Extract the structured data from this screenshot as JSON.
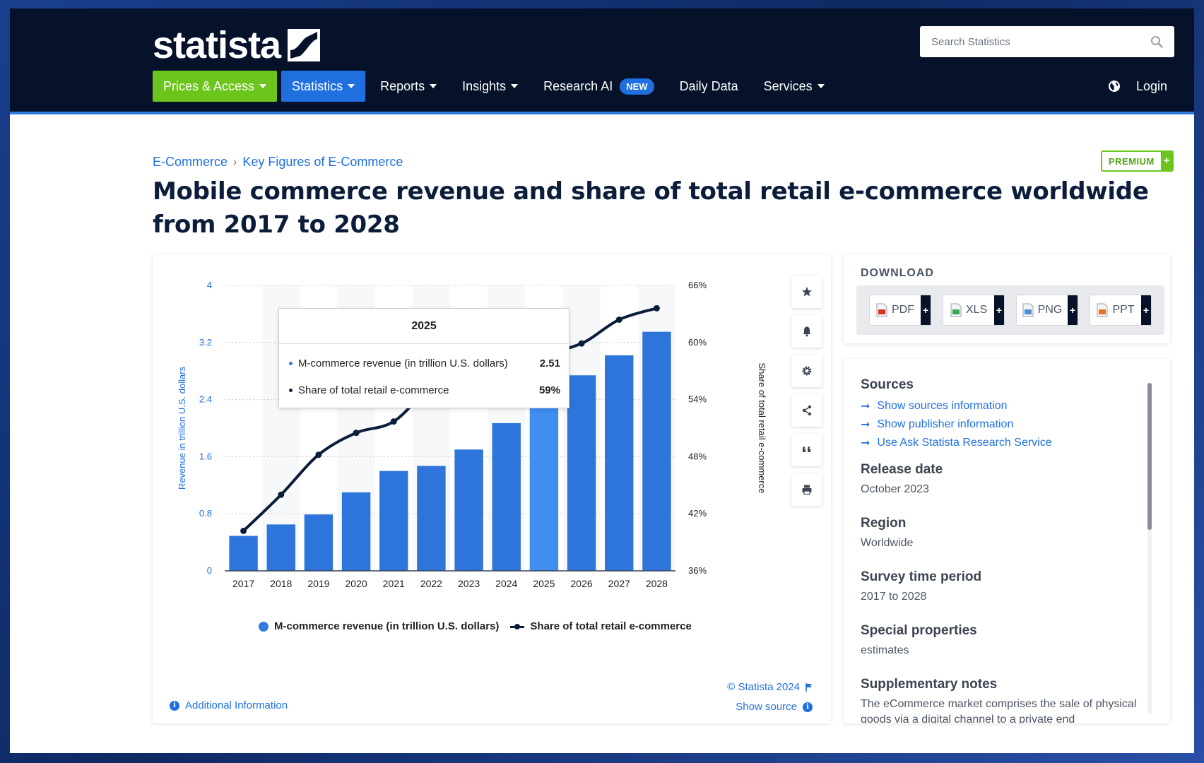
{
  "header": {
    "logo_text": "statista",
    "search_placeholder": "Search Statistics",
    "nav": [
      {
        "label": "Prices & Access",
        "style": "green",
        "caret": true
      },
      {
        "label": "Statistics",
        "style": "blue",
        "caret": true
      },
      {
        "label": "Reports",
        "style": "",
        "caret": true
      },
      {
        "label": "Insights",
        "style": "",
        "caret": true
      },
      {
        "label": "Research AI",
        "style": "",
        "caret": false,
        "badge": "NEW"
      },
      {
        "label": "Daily Data",
        "style": "",
        "caret": false
      },
      {
        "label": "Services",
        "style": "",
        "caret": true
      }
    ],
    "login_label": "Login"
  },
  "breadcrumb": {
    "items": [
      "E-Commerce",
      "Key Figures of E-Commerce"
    ],
    "separator": "›"
  },
  "premium_label": "PREMIUM",
  "premium_plus": "+",
  "title": "Mobile commerce revenue and share of total retail e-commerce worldwide from 2017 to 2028",
  "chart_data": {
    "type": "bar",
    "categories": [
      "2017",
      "2018",
      "2019",
      "2020",
      "2021",
      "2022",
      "2023",
      "2024",
      "2025",
      "2026",
      "2027",
      "2028"
    ],
    "series": [
      {
        "name": "M-commerce revenue (in trillion U.S. dollars)",
        "type": "bar",
        "axis": "left",
        "values": [
          0.49,
          0.65,
          0.79,
          1.1,
          1.4,
          1.47,
          1.7,
          2.07,
          2.51,
          2.74,
          3.02,
          3.35
        ]
      },
      {
        "name": "Share of total retail e-commerce",
        "type": "line",
        "axis": "right",
        "values": [
          40.2,
          44,
          48.2,
          50.5,
          51.7,
          55.5,
          58.2,
          59.5,
          59,
          59.9,
          62.4,
          63.6
        ]
      }
    ],
    "ylabel": "Revenue in trillion U.S. dollars",
    "y2label": "Share of total retail e-commerce",
    "ylim": [
      0,
      4
    ],
    "yticks": [
      "0",
      "0.8",
      "1.6",
      "2.4",
      "3.2",
      "4"
    ],
    "y2lim": [
      36,
      66
    ],
    "y2ticks": [
      "36%",
      "42%",
      "48%",
      "54%",
      "60%",
      "66%"
    ],
    "highlight_index": 8,
    "colors": {
      "bar": "#2d74db",
      "bar_highlight": "#3f8ef0",
      "line": "#0b1d3a"
    },
    "legend_position": "bottom",
    "grid": true,
    "tooltip": {
      "title": "2025",
      "rows": [
        {
          "label": "M-commerce revenue (in trillion U.S. dollars)",
          "value": "2.51"
        },
        {
          "label": "Share of total retail e-commerce",
          "value": "59%"
        }
      ]
    }
  },
  "chart_footer": {
    "copyright": "© Statista 2024",
    "show_source": "Show source",
    "additional_info": "Additional Information"
  },
  "tools": [
    "star-icon",
    "bell-icon",
    "gear-icon",
    "share-icon",
    "quote-icon",
    "print-icon"
  ],
  "download": {
    "title": "DOWNLOAD",
    "buttons": [
      {
        "label": "PDF",
        "icon": "pdf-file-icon"
      },
      {
        "label": "XLS",
        "icon": "xls-file-icon"
      },
      {
        "label": "PNG",
        "icon": "png-file-icon"
      },
      {
        "label": "PPT",
        "icon": "ppt-file-icon"
      }
    ],
    "plus": "+"
  },
  "info": {
    "sources_title": "Sources",
    "source_links": [
      "Show sources information",
      "Show publisher information",
      "Use Ask Statista Research Service"
    ],
    "release_date_title": "Release date",
    "release_date": "October 2023",
    "region_title": "Region",
    "region": "Worldwide",
    "survey_title": "Survey time period",
    "survey": "2017 to 2028",
    "special_title": "Special properties",
    "special": "estimates",
    "notes_title": "Supplementary notes",
    "notes": "The eCommerce market comprises the sale of physical goods via a digital channel to a private end"
  }
}
